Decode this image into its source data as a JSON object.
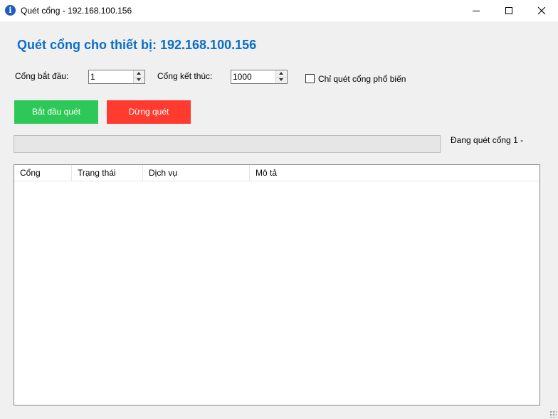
{
  "window": {
    "title": "Quét cổng - 192.168.100.156",
    "icon": "info-icon"
  },
  "header": {
    "heading": "Quét cổng cho thiết bị: 192.168.100.156"
  },
  "form": {
    "start_port_label": "Cổng bắt đầu:",
    "start_port_value": "1",
    "end_port_label": "Cổng kết thúc:",
    "end_port_value": "1000",
    "common_only_label": "Chỉ quét cổng phổ biến",
    "common_only_checked": false
  },
  "actions": {
    "start_label": "Bắt đầu quét",
    "stop_label": "Dừng quét"
  },
  "progress": {
    "value": 0,
    "status_text": "Đang quét cổng 1 -"
  },
  "results": {
    "columns": [
      "Cổng",
      "Trạng thái",
      "Dịch vụ",
      "Mô tả"
    ],
    "rows": []
  },
  "colors": {
    "accent": "#0a6fc8",
    "start_button": "#2ec858",
    "stop_button": "#ff3b30"
  }
}
